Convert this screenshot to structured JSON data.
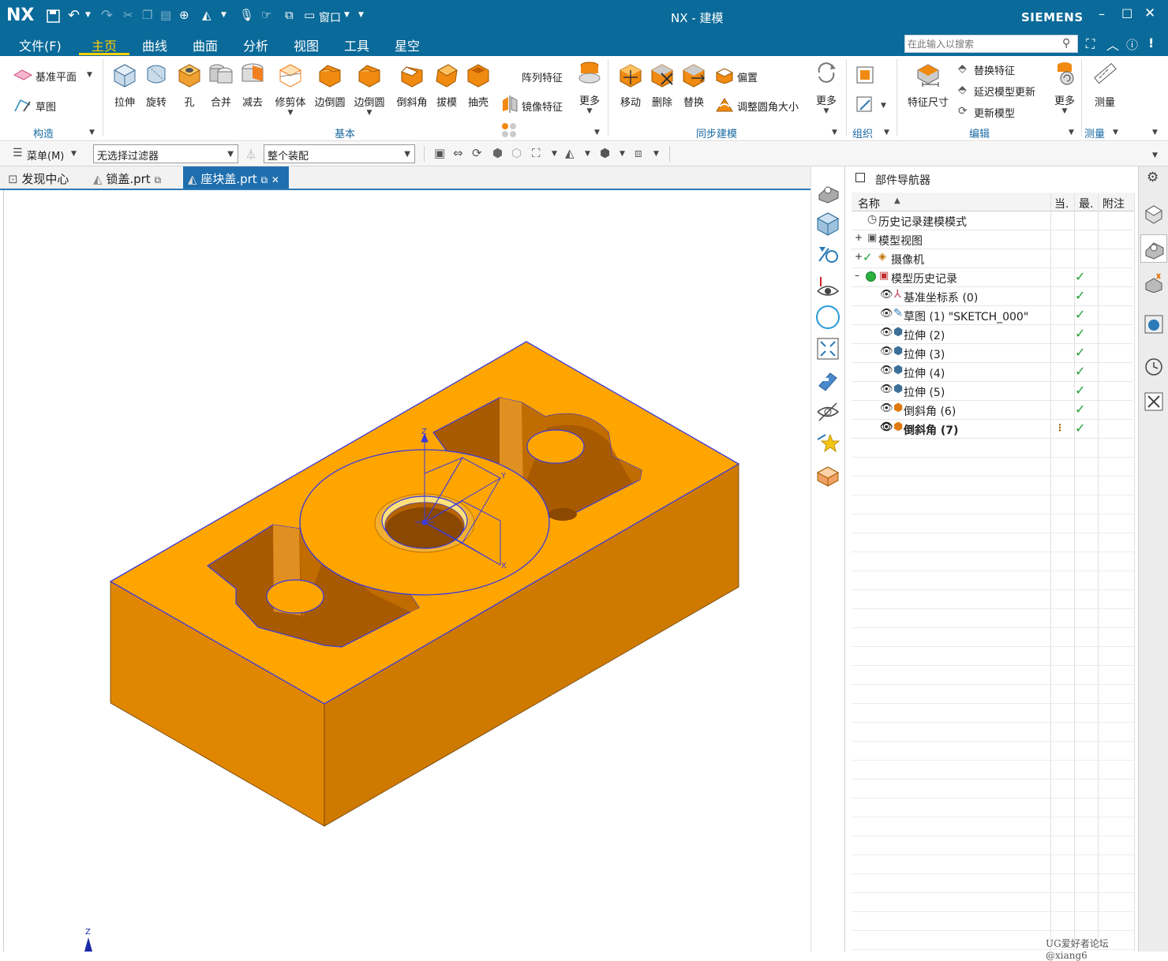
{
  "titlebar": {
    "logo": "NX",
    "window_menu": "窗口",
    "title": "NX - 建模",
    "brand": "SIEMENS",
    "icons": [
      "save-icon",
      "undo-icon",
      "redo-icon",
      "cut-icon",
      "copy-icon",
      "paste-icon",
      "repeat-icon",
      "part-icon",
      "mic-icon",
      "touch-icon",
      "window-icon"
    ]
  },
  "menubar": {
    "items": [
      "文件(F)",
      "主页",
      "曲线",
      "曲面",
      "分析",
      "视图",
      "工具",
      "星空"
    ],
    "active": "主页",
    "search_placeholder": "在此输入以搜索"
  },
  "ribbon": {
    "construct": {
      "datum_plane": "基准平面",
      "sketch": "草图",
      "label": "构造"
    },
    "basic": {
      "buttons": [
        "拉伸",
        "旋转",
        "孔",
        "合并",
        "减去",
        "修剪体",
        "边倒圆",
        "边倒圆",
        "倒斜角",
        "拔模",
        "抽壳"
      ],
      "pattern": "阵列特征",
      "mirror": "镜像特征",
      "more": "更多",
      "label": "基本"
    },
    "sync": {
      "buttons": [
        "移动",
        "删除",
        "替换"
      ],
      "offset": "偏置",
      "resize_blend": "调整圆角大小",
      "more": "更多",
      "label": "同步建模"
    },
    "organize": {
      "label": "组织"
    },
    "edit": {
      "feature_dim": "特征尺寸",
      "replace_feature": "替换特征",
      "delay_update": "延迟模型更新",
      "update_model": "更新模型",
      "more": "更多",
      "label": "编辑"
    },
    "measure": {
      "button": "测量",
      "label": "测量"
    }
  },
  "filterbar": {
    "menu": "菜单(M)",
    "filter": "无选择过滤器",
    "scope": "整个装配"
  },
  "tabs": [
    {
      "label": "发现中心"
    },
    {
      "label": "锁盖.prt"
    },
    {
      "label": "座块盖.prt"
    }
  ],
  "navigator": {
    "title": "部件导航器",
    "columns": [
      "名称",
      "当.",
      "最.",
      "附注"
    ],
    "rows": [
      {
        "label": "历史记录建模模式",
        "check": false
      },
      {
        "label": "模型视图",
        "check": false
      },
      {
        "label": "摄像机",
        "check": false
      },
      {
        "label": "模型历史记录",
        "check": true
      },
      {
        "label": "基准坐标系 (0)",
        "check": true
      },
      {
        "label": "草图 (1) \"SKETCH_000\"",
        "check": true
      },
      {
        "label": "拉伸 (2)",
        "check": true
      },
      {
        "label": "拉伸 (3)",
        "check": true
      },
      {
        "label": "拉伸 (4)",
        "check": true
      },
      {
        "label": "拉伸 (5)",
        "check": true
      },
      {
        "label": "倒斜角 (6)",
        "check": true
      },
      {
        "label": "倒斜角 (7)",
        "check": true
      }
    ]
  },
  "viewport": {
    "axis_z": "Z",
    "axis_y": "Y",
    "axis_x": "X",
    "triad_z": "Z",
    "watermark": "UG爱好者论坛@xiang6"
  },
  "colors": {
    "titlebar": "#0a6a99",
    "part_top": "#ffa500",
    "part_side_dark": "#d98000",
    "part_side": "#e88a00",
    "edge": "#3a3adf",
    "check": "#21a038"
  }
}
